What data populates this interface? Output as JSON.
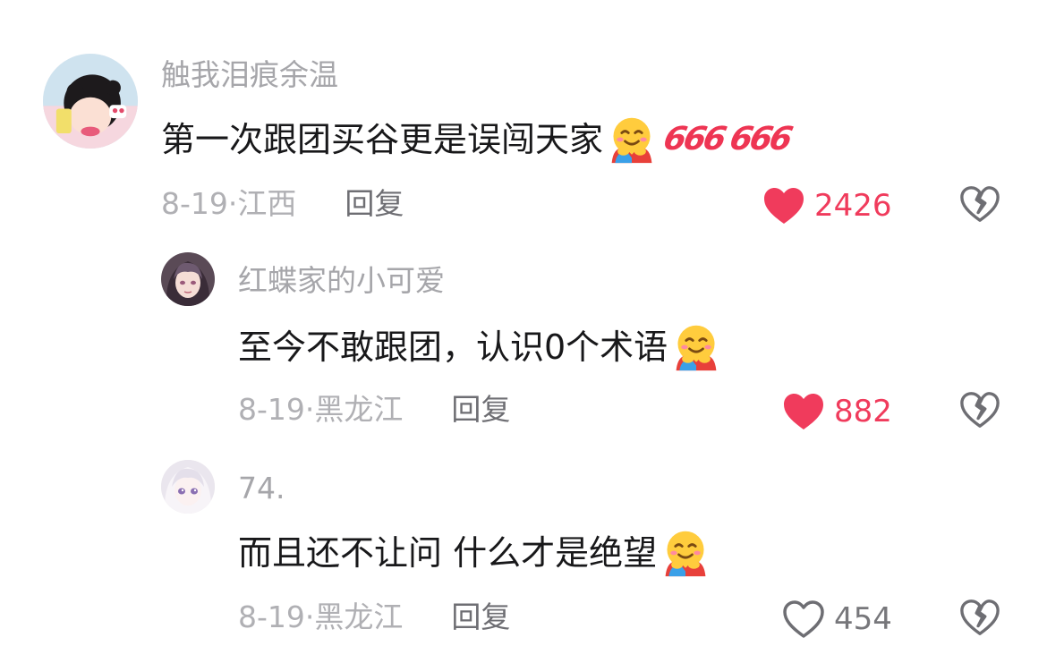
{
  "comments": [
    {
      "username": "触我泪痕余温",
      "text": "第一次跟团买谷更是误闯天家",
      "emoji": "hugging-face-emoji",
      "badges": [
        "666",
        "666"
      ],
      "date": "8-19",
      "location": "江西",
      "reply_label": "回复",
      "likes": "2426",
      "liked": true
    },
    {
      "username": "红蝶家的小可爱",
      "text": "至今不敢跟团，认识0个术语",
      "emoji": "hugging-face-emoji",
      "date": "8-19",
      "location": "黑龙江",
      "reply_label": "回复",
      "likes": "882",
      "liked": true
    },
    {
      "username": "74.",
      "text": "而且还不让问 什么才是绝望",
      "emoji": "hugging-face-emoji",
      "date": "8-19",
      "location": "黑龙江",
      "reply_label": "回复",
      "likes": "454",
      "liked": false
    }
  ],
  "colors": {
    "liked": "#f03b5c",
    "meta": "#b0b0b4",
    "username": "#a6a6aa",
    "text": "#18181a"
  }
}
